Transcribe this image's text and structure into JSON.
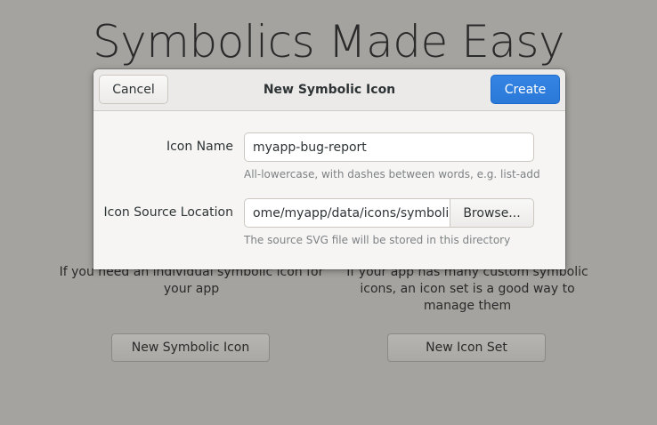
{
  "background": {
    "title": "Symbolics Made Easy",
    "left_description": "If you need an individual symbolic icon for your app",
    "right_description": "If your app has many custom symbolic icons, an icon set is a good way to manage them",
    "new_symbolic_icon_button": "New Symbolic Icon",
    "new_icon_set_button": "New Icon Set"
  },
  "dialog": {
    "title": "New Symbolic Icon",
    "cancel_label": "Cancel",
    "create_label": "Create",
    "icon_name": {
      "label": "Icon Name",
      "value": "myapp-bug-report",
      "hint": "All-lowercase, with dashes between words, e.g. list-add"
    },
    "icon_source": {
      "label": "Icon Source Location",
      "value": "ome/myapp/data/icons/symbolic",
      "browse_label": "Browse...",
      "hint": "The source SVG file will be stored in this directory"
    }
  },
  "colors": {
    "accent": "#3584e4",
    "backdrop": "#a4a39f",
    "dialog_bg": "#f6f5f4"
  }
}
